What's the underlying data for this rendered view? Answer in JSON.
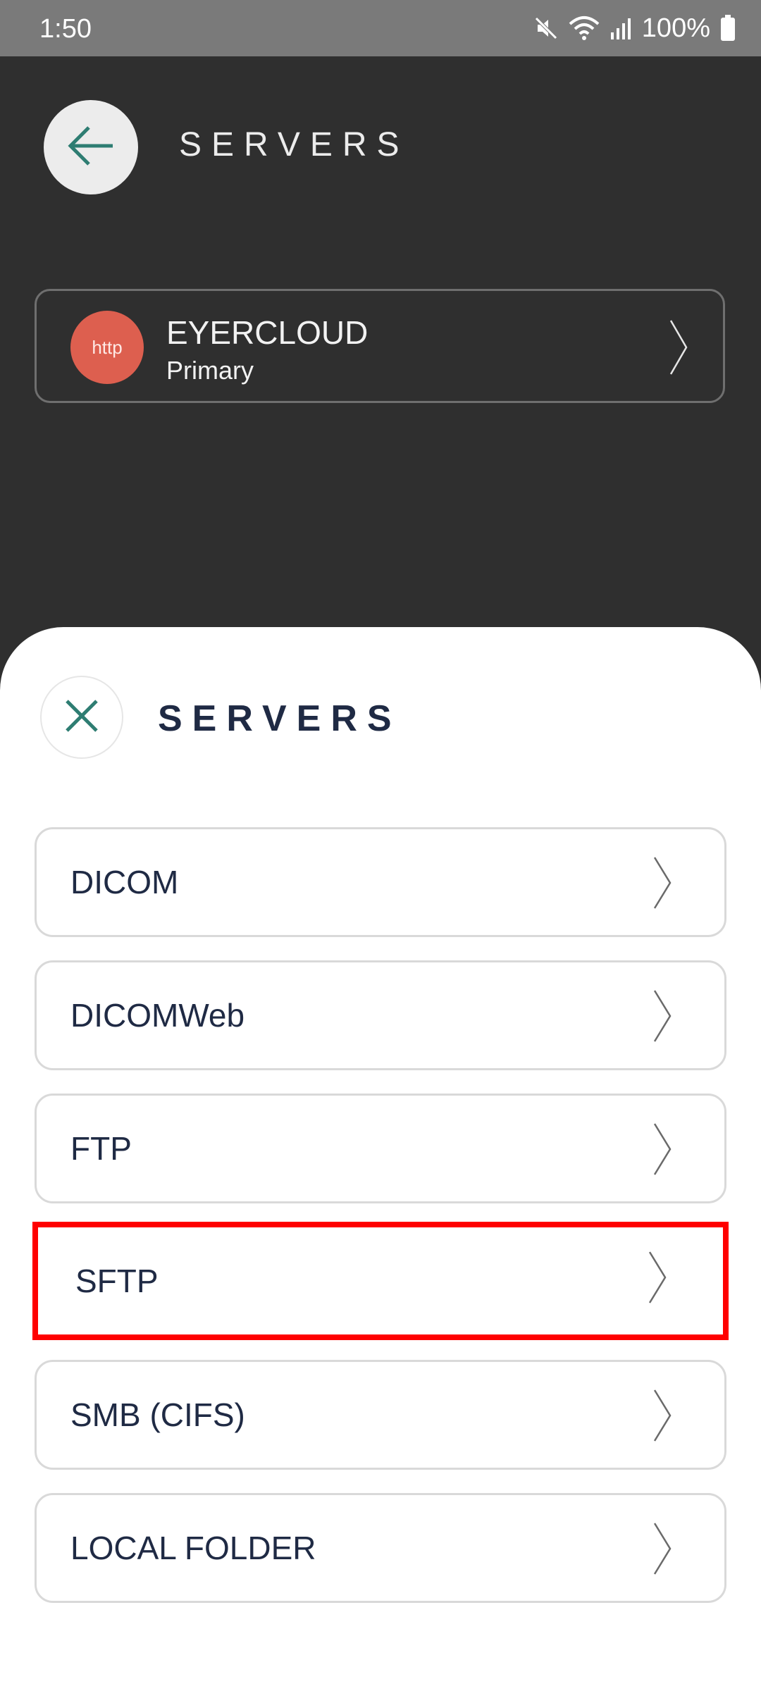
{
  "status_bar": {
    "time": "1:50",
    "battery": "100%",
    "icons": [
      "mute-icon",
      "wifi-icon",
      "signal-icon",
      "battery-icon"
    ]
  },
  "background_page": {
    "title": "SERVERS",
    "back_icon": "arrow-left-icon",
    "server": {
      "badge": "http",
      "name": "EYERCLOUD",
      "role": "Primary"
    }
  },
  "sheet": {
    "title": "SERVERS",
    "close_icon": "close-icon",
    "options": [
      {
        "label": "DICOM"
      },
      {
        "label": "DICOMWeb"
      },
      {
        "label": "FTP"
      },
      {
        "label": "SFTP",
        "highlighted": true
      },
      {
        "label": "SMB (CIFS)"
      },
      {
        "label": "LOCAL FOLDER"
      }
    ]
  },
  "colors": {
    "accent": "#2e7d72",
    "http_badge": "#dd5f4f",
    "highlight": "#ff0000",
    "text_dark": "#1f2a44"
  }
}
